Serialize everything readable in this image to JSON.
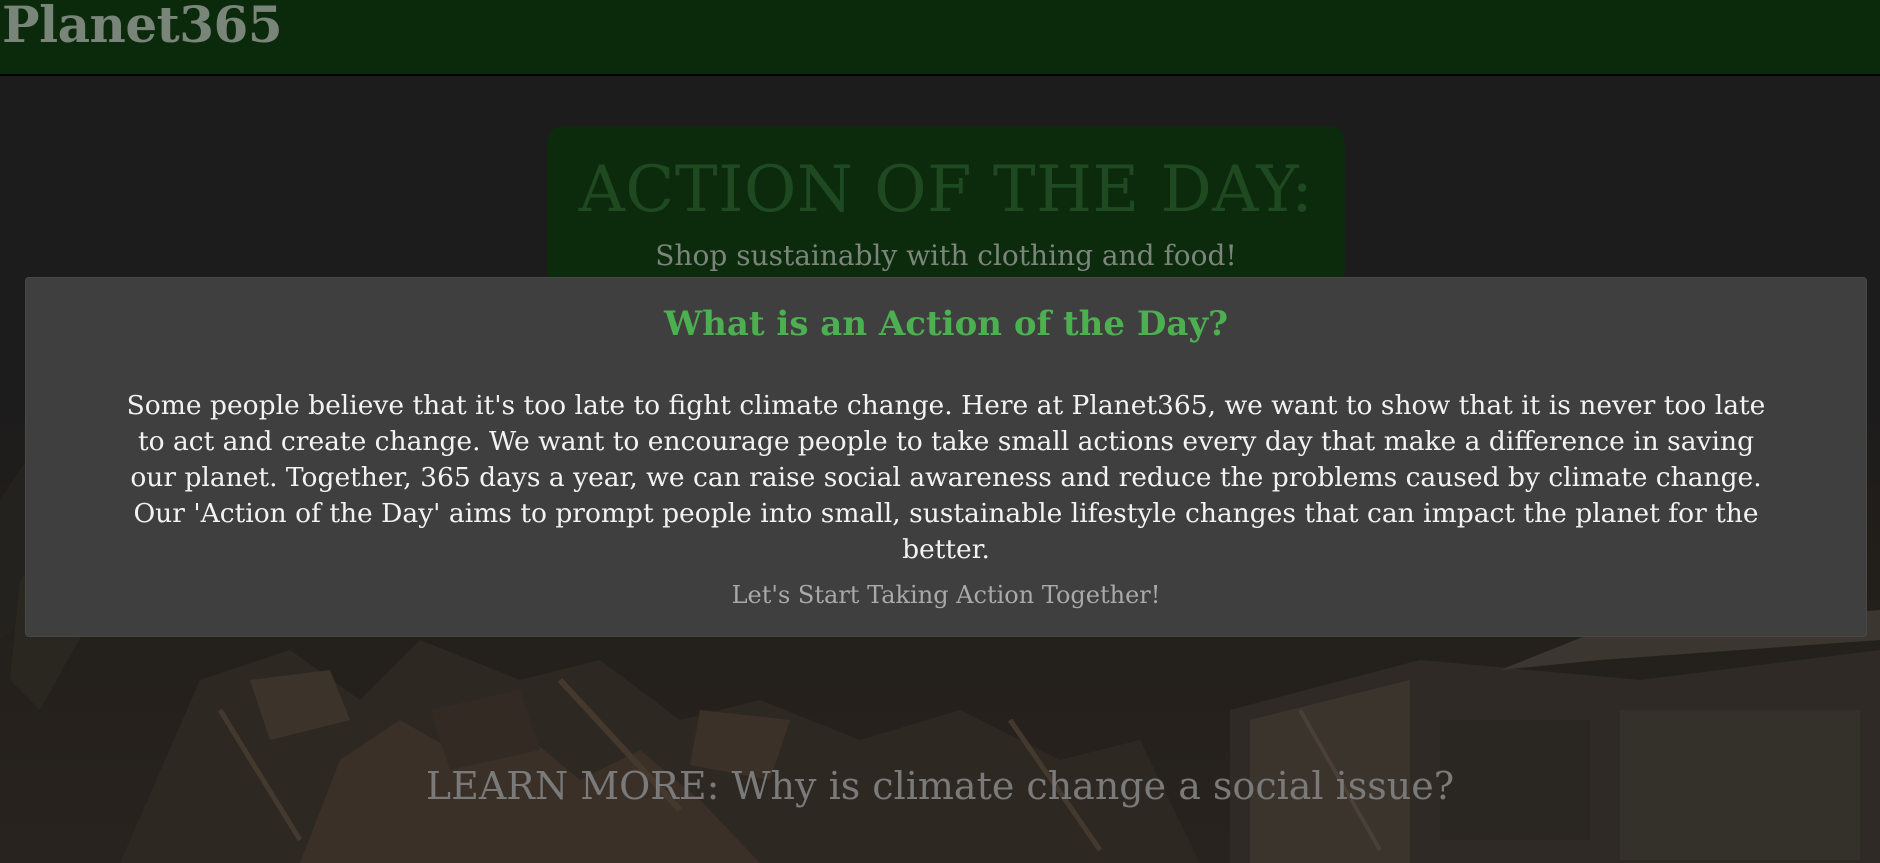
{
  "header": {
    "logo_text": "Planet365"
  },
  "action_of_day": {
    "title": "ACTION OF THE DAY:",
    "subtitle": "Shop sustainably with clothing and food!"
  },
  "learn_more": {
    "label": "LEARN MORE: Why is climate change a social issue?"
  },
  "modal": {
    "title": "What is an Action of the Day?",
    "body": "Some people believe that it's too late to fight climate change. Here at Planet365, we want to show that it is never too late to act and create change. We want to encourage people to take small actions every day that make a difference in saving our planet. Together, 365 days a year, we can raise social awareness and reduce the problems caused by climate change. Our 'Action of the Day' aims to prompt people into small, sustainable lifestyle changes that can impact the planet for the better.",
    "cta_label": "Let's Start Taking Action Together!"
  },
  "colors": {
    "header_bg": "#0b2a0c",
    "accent_green": "#4caf50",
    "modal_bg": "#3f3f3f"
  }
}
